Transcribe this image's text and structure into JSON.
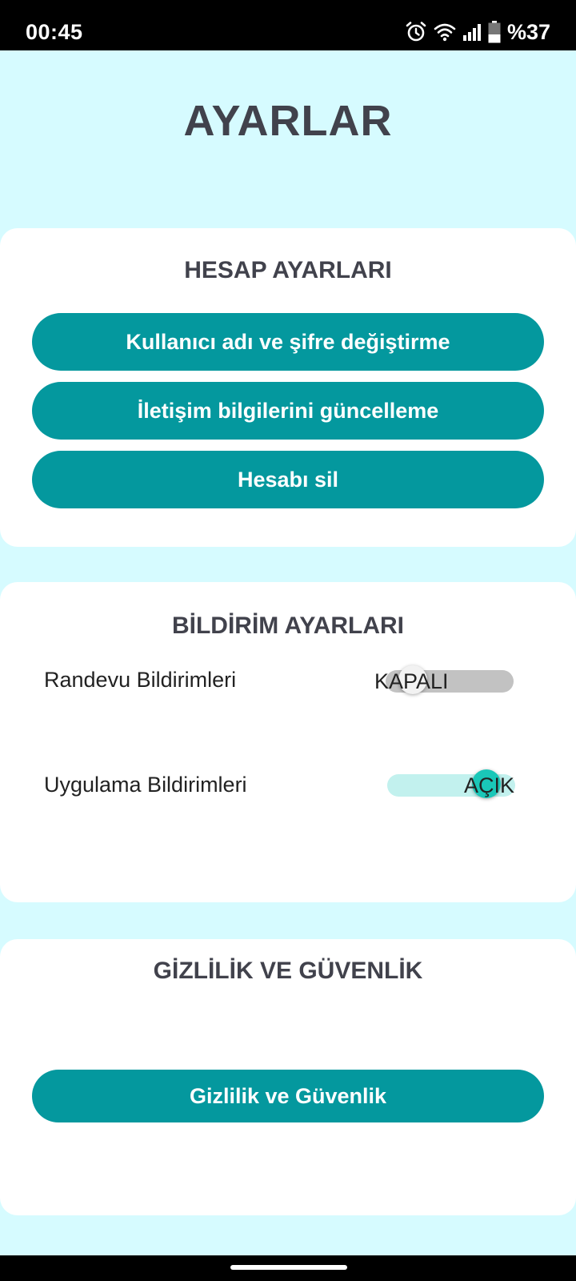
{
  "status_bar": {
    "time": "00:45",
    "icons": [
      "alarm-icon",
      "wifi-icon",
      "signal-icon",
      "battery-icon"
    ],
    "battery_percent": "%37",
    "battery_level": 0.37
  },
  "page": {
    "title": "AYARLAR"
  },
  "account_section": {
    "title": "HESAP AYARLARI",
    "buttons": [
      {
        "label": "Kullanıcı adı ve şifre değiştirme"
      },
      {
        "label": "İletişim bilgilerini güncelleme"
      },
      {
        "label": "Hesabı sil"
      }
    ]
  },
  "notification_section": {
    "title": "BİLDİRİM AYARLARI",
    "toggles": [
      {
        "label": "Randevu Bildirimleri",
        "state_text": "KAPALI",
        "on": false
      },
      {
        "label": "Uygulama Bildirimleri",
        "state_text": "AÇIK",
        "on": true
      }
    ]
  },
  "privacy_section": {
    "title": "GİZLİLİK VE GÜVENLİK",
    "button_label": "Gizlilik ve Güvenlik"
  },
  "colors": {
    "background": "#d6fbff",
    "card": "#ffffff",
    "primary_button": "#04989e",
    "title_text": "#41424c",
    "toggle_on_knob": "#1ac7b8",
    "toggle_on_track": "#c2f1ee",
    "toggle_off_track": "#c2c2c2"
  }
}
